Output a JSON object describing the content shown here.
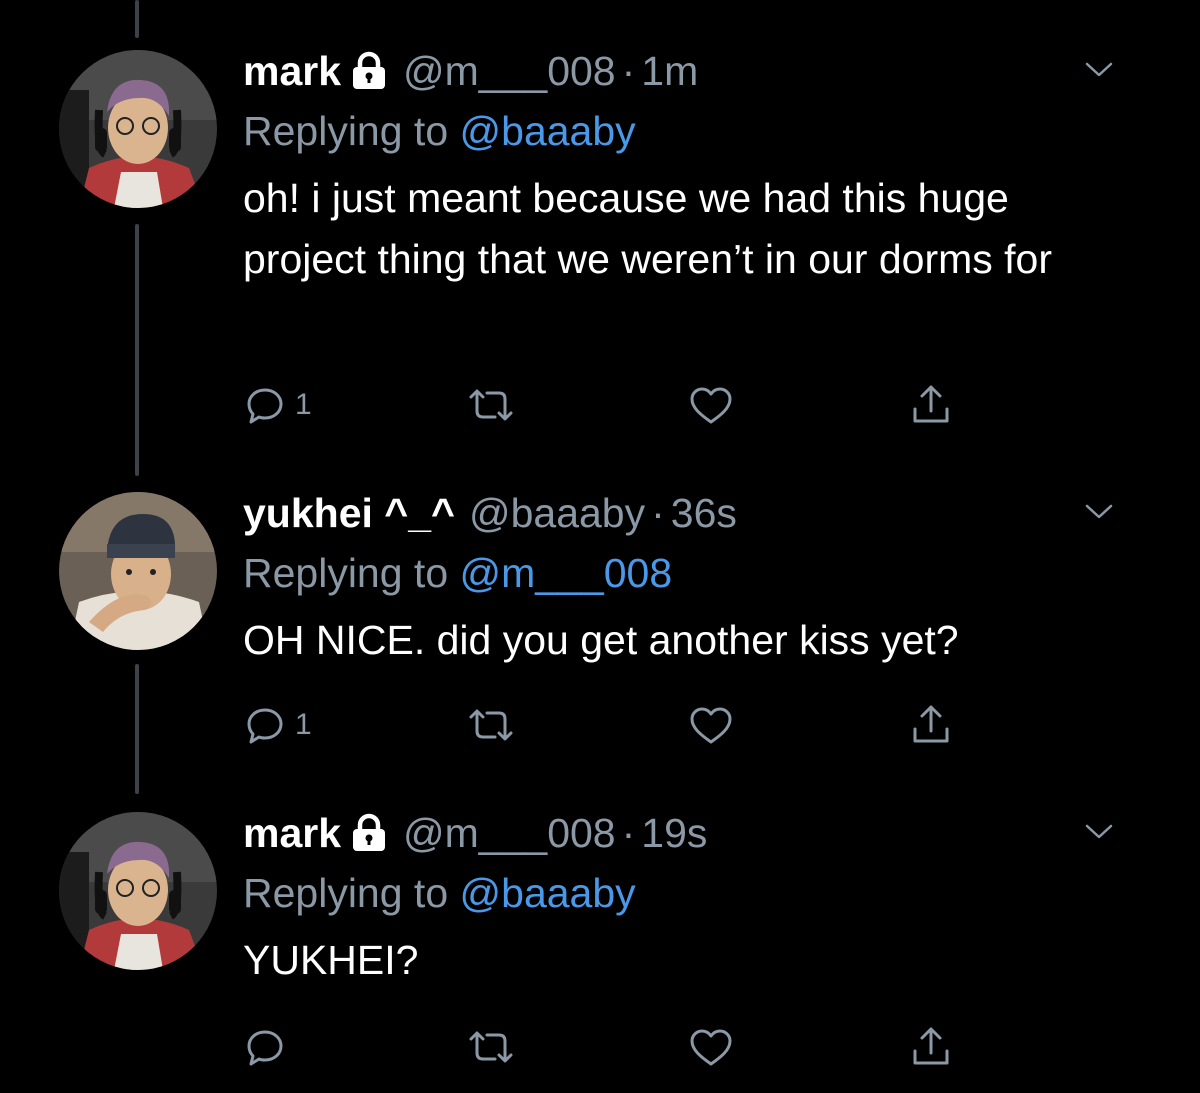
{
  "colors": {
    "background": "#000000",
    "primary_text": "#ffffff",
    "secondary_text": "#8b98a5",
    "mention": "#4a99e9",
    "thread_line": "#3d4148"
  },
  "tweets": [
    {
      "display_name": "mark",
      "protected": true,
      "lock_icon": "lock-icon",
      "handle": "@m___008",
      "separator": "·",
      "timestamp": "1m",
      "reply_prefix": "Replying to",
      "reply_to": "@baaaby",
      "text": "oh! i just meant because we had this huge project thing that we weren’t in our dorms for",
      "reply_count": "1",
      "icons": [
        "reply-icon",
        "retweet-icon",
        "like-icon",
        "share-icon",
        "chevron-down-icon"
      ]
    },
    {
      "display_name": "yukhei ^_^",
      "protected": false,
      "handle": "@baaaby",
      "separator": "·",
      "timestamp": "36s",
      "reply_prefix": "Replying to",
      "reply_to": "@m___008",
      "text": "OH NICE. did you get another kiss yet?",
      "reply_count": "1",
      "icons": [
        "reply-icon",
        "retweet-icon",
        "like-icon",
        "share-icon",
        "chevron-down-icon"
      ]
    },
    {
      "display_name": "mark",
      "protected": true,
      "lock_icon": "lock-icon",
      "handle": "@m___008",
      "separator": "·",
      "timestamp": "19s",
      "reply_prefix": "Replying to",
      "reply_to": "@baaaby",
      "text": "YUKHEI?",
      "reply_count": "",
      "icons": [
        "reply-icon",
        "retweet-icon",
        "like-icon",
        "share-icon",
        "chevron-down-icon"
      ]
    }
  ]
}
